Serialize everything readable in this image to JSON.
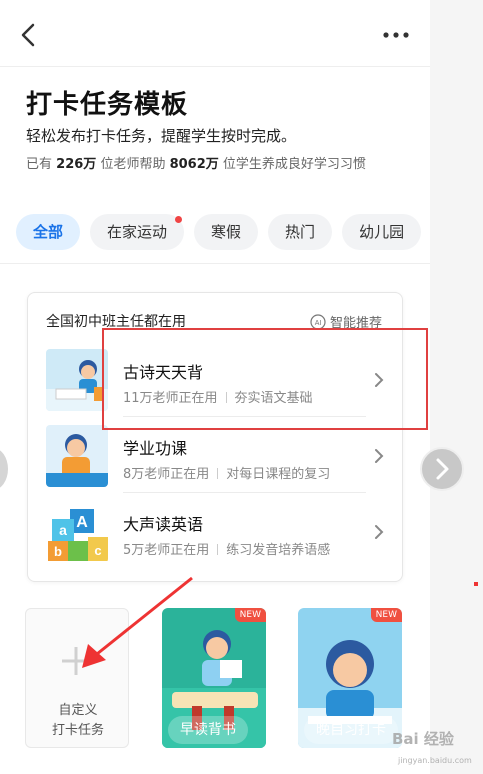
{
  "header": {
    "title": "打卡任务模板",
    "subtitle": "轻松发布打卡任务，提醒学生按时完成。",
    "stats": {
      "prefix": "已有",
      "teachers": "226万",
      "middle": "位老师帮助",
      "students": "8062万",
      "suffix": "位学生养成良好学习习惯"
    }
  },
  "nav": {
    "back_icon": "chevron-left-icon",
    "more_icon": "more-dots-icon"
  },
  "tabs": [
    {
      "label": "全部",
      "active": true
    },
    {
      "label": "在家运动",
      "dot": true
    },
    {
      "label": "寒假"
    },
    {
      "label": "热门"
    },
    {
      "label": "幼儿园"
    }
  ],
  "card": {
    "heading": "全国初中班主任都在用",
    "smart_label": "智能推荐",
    "items": [
      {
        "name": "古诗天天背",
        "users": "11万老师正在用",
        "desc": "夯实语文基础"
      },
      {
        "name": "学业功课",
        "users": "8万老师正在用",
        "desc": "对每日课程的复习"
      },
      {
        "name": "大声读英语",
        "users": "5万老师正在用",
        "desc": "练习发音培养语感"
      }
    ]
  },
  "templates": {
    "custom": {
      "line1": "自定义",
      "line2": "打卡任务"
    },
    "items": [
      {
        "label": "早读背书",
        "badge": "NEW"
      },
      {
        "label": "晚自习打卡",
        "badge": "NEW"
      }
    ]
  },
  "watermark": {
    "text": "Bai 经验",
    "sub": "jingyan.baidu.com"
  },
  "colors": {
    "accent": "#1a73e8",
    "highlight": "#e04040",
    "badge": "#f05040"
  }
}
